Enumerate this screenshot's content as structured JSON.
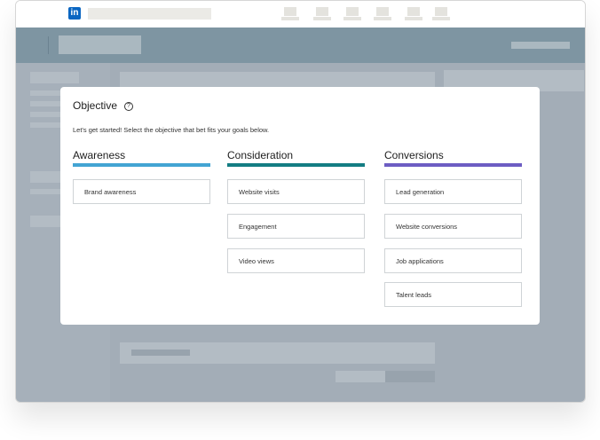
{
  "topnav": {
    "logo_text": "in",
    "logo_color": "#0a66c2",
    "icons": [
      "home-icon",
      "network-icon",
      "jobs-icon",
      "messaging-icon",
      "notifications-icon",
      "profile-icon"
    ]
  },
  "modal": {
    "title": "Objective",
    "help_icon_glyph": "?",
    "description": "Let's get started! Select the objective that bet fits your goals below.",
    "columns": [
      {
        "heading": "Awareness",
        "color": "#43a4d3",
        "options": [
          "Brand awareness"
        ]
      },
      {
        "heading": "Consideration",
        "color": "#147d83",
        "options": [
          "Website visits",
          "Engagement",
          "Video views"
        ]
      },
      {
        "heading": "Conversions",
        "color": "#6d5dc3",
        "options": [
          "Lead generation",
          "Website conversions",
          "Job applications",
          "Talent leads"
        ]
      }
    ]
  }
}
